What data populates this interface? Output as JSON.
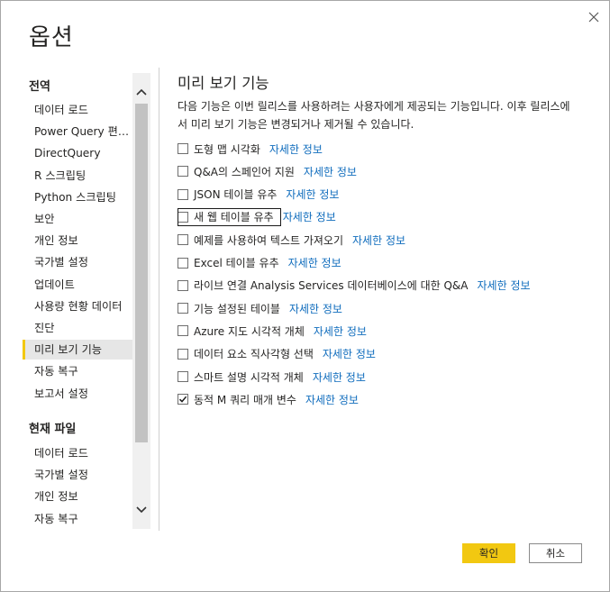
{
  "dialog": {
    "title": "옵션",
    "close_icon": "close-icon"
  },
  "nav": {
    "global_header": "전역",
    "global_items": [
      {
        "label": "데이터 로드"
      },
      {
        "label": "Power Query 편집..."
      },
      {
        "label": "DirectQuery"
      },
      {
        "label": "R 스크립팅"
      },
      {
        "label": "Python 스크립팅"
      },
      {
        "label": "보안"
      },
      {
        "label": "개인 정보"
      },
      {
        "label": "국가별 설정"
      },
      {
        "label": "업데이트"
      },
      {
        "label": "사용량 현황 데이터"
      },
      {
        "label": "진단"
      },
      {
        "label": "미리 보기 기능"
      },
      {
        "label": "자동 복구"
      },
      {
        "label": "보고서 설정"
      }
    ],
    "selected_item": "미리 보기 기능",
    "file_header": "현재 파일",
    "file_items": [
      {
        "label": "데이터 로드"
      },
      {
        "label": "국가별 설정"
      },
      {
        "label": "개인 정보"
      },
      {
        "label": "자동 복구"
      }
    ]
  },
  "content": {
    "section_title": "미리 보기 기능",
    "description": "다음 기능은 이번 릴리스를 사용하려는 사용자에게 제공되는 기능입니다. 이후 릴리스에서 미리 보기 기능은 변경되거나 제거될 수 있습니다.",
    "link_label": "자세한 정보",
    "features": [
      {
        "label": "도형 맵 시각화",
        "checked": false
      },
      {
        "label": "Q&A의 스페인어 지원",
        "checked": false
      },
      {
        "label": "JSON 테이블 유추",
        "checked": false
      },
      {
        "label": "새 웹 테이블 유추",
        "checked": false
      },
      {
        "label": "예제를 사용하여 텍스트 가져오기",
        "checked": false
      },
      {
        "label": "Excel 테이블 유추",
        "checked": false
      },
      {
        "label": "라이브 연결 Analysis Services 데이터베이스에 대한 Q&A",
        "checked": false
      },
      {
        "label": "기능 설정된 테이블",
        "checked": false
      },
      {
        "label": "Azure 지도 시각적 개체",
        "checked": false
      },
      {
        "label": "데이터 요소 직사각형 선택",
        "checked": false
      },
      {
        "label": "스마트 설명 시각적 개체",
        "checked": false
      },
      {
        "label": "동적 M 쿼리 매개 변수",
        "checked": true
      }
    ]
  },
  "footer": {
    "ok_label": "확인",
    "cancel_label": "취소"
  },
  "colors": {
    "accent": "#f2c811",
    "link": "#0f6cbd",
    "selected_bg": "#e6e6e6"
  }
}
